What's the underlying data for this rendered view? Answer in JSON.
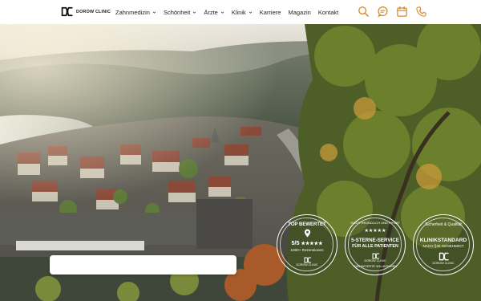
{
  "brand": {
    "name": "DOROW CLINIC"
  },
  "nav": {
    "items": [
      {
        "label": "Zahnmedizin",
        "has_dropdown": true
      },
      {
        "label": "Schönheit",
        "has_dropdown": true
      },
      {
        "label": "Ärzte",
        "has_dropdown": true
      },
      {
        "label": "Klinik",
        "has_dropdown": true
      },
      {
        "label": "Karriere",
        "has_dropdown": false
      },
      {
        "label": "Magazin",
        "has_dropdown": false
      },
      {
        "label": "Kontakt",
        "has_dropdown": false
      }
    ],
    "icons": [
      "search-icon",
      "chat-icon",
      "calendar-icon",
      "phone-icon"
    ]
  },
  "colors": {
    "accent": "#d4882b",
    "header_bg": "#ffffff",
    "text": "#222222"
  },
  "search": {
    "value": ""
  },
  "badges": {
    "top": {
      "arc_text": "TOP BEWERTET",
      "rating": "5/5",
      "stars": "★★★★★",
      "reviews": "1000+ Rezensionen",
      "brand": "DOROW CLINIC"
    },
    "service": {
      "arc_top": "GASTFREUNDLICH UND PRIVAT",
      "stars": "★★★★★",
      "line1": "5-STERNE-SERVICE",
      "line2": "FÜR ALLE PATIENTEN",
      "arc_bottom": "GARANTIERTE WILLKOMMEN",
      "brand": "DOROW CLINIC"
    },
    "quality": {
      "arc_text": "Sicherheit & Qualität",
      "line1": "KLINIKSTANDARD",
      "line2": "NACH §30 GENEHMIGT",
      "brand": "DOROW CLINIC"
    }
  }
}
